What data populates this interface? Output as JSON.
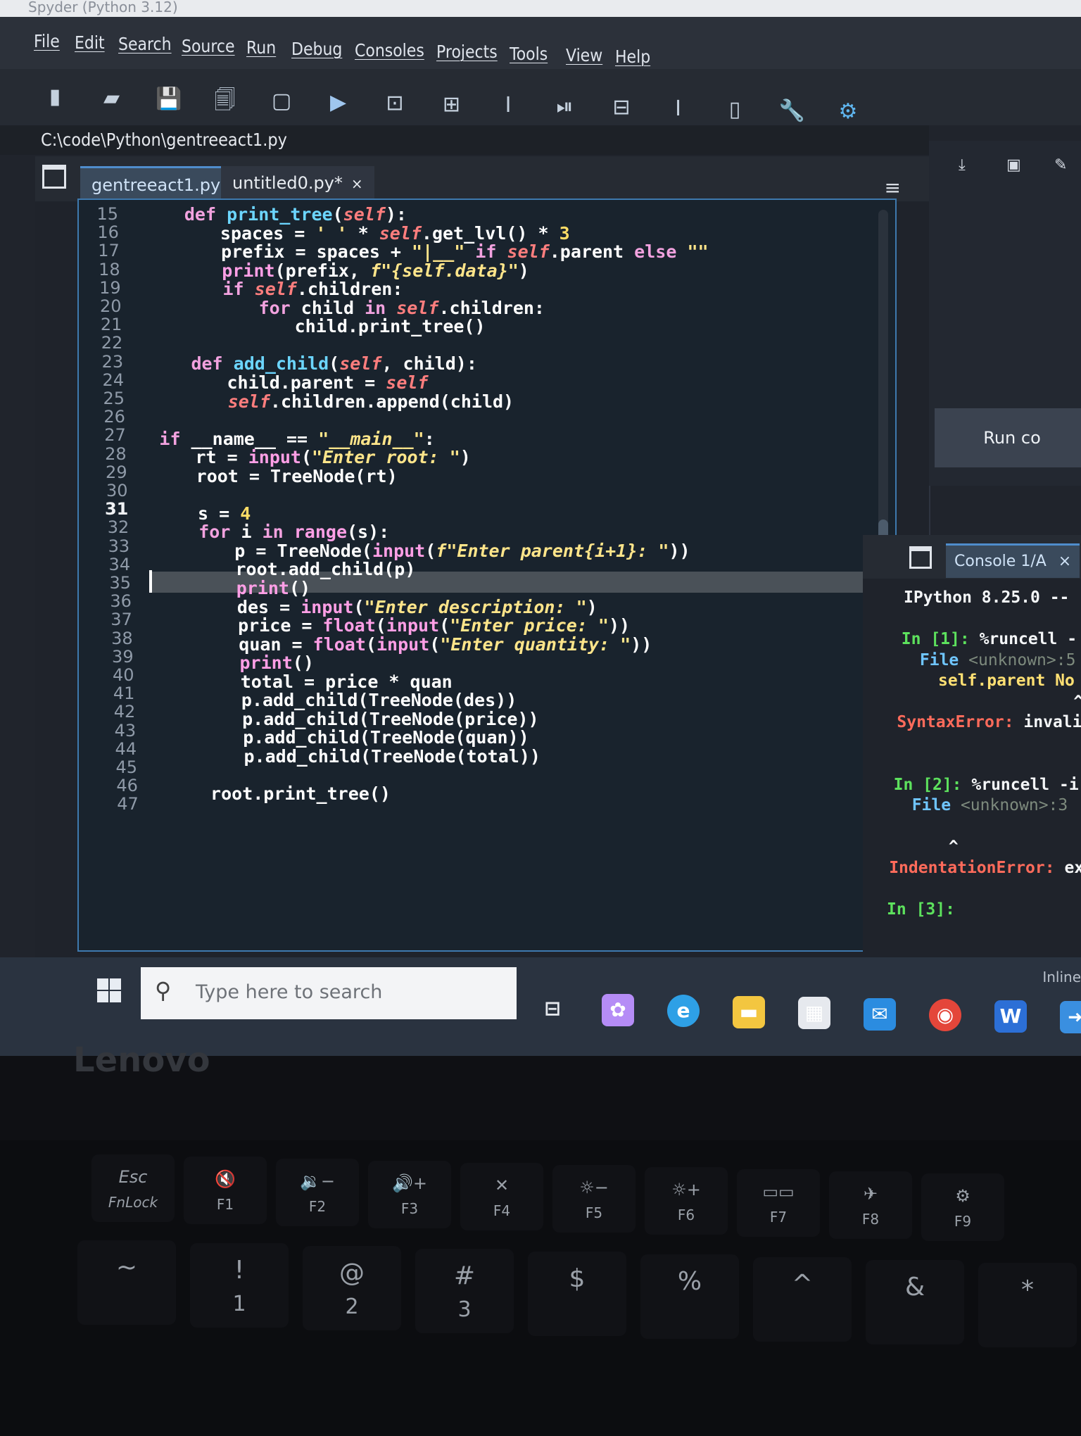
{
  "window": {
    "title": "Spyder (Python 3.12)"
  },
  "menubar": [
    "File",
    "Edit",
    "Search",
    "Source",
    "Run",
    "Debug",
    "Consoles",
    "Projects",
    "Tools",
    "View",
    "Help"
  ],
  "toolbar": {
    "icons": [
      "new-file-icon",
      "open-folder-icon",
      "save-icon",
      "save-all-icon",
      "new-cell-icon",
      "run-icon",
      "run-cell-icon",
      "run-cell-advance-icon",
      "run-selection-icon",
      "debug-icon",
      "debug-cell-icon",
      "debug-selection-icon",
      "maximize-pane-icon",
      "preferences-wrench-icon",
      "python-path-icon"
    ]
  },
  "editor": {
    "path": "C:\\code\\Python\\gentreeact1.py",
    "tabs": [
      {
        "label": "gentreeact1.py",
        "close": "×",
        "active": true
      },
      {
        "label": "untitled0.py*",
        "close": "×",
        "active": false
      }
    ],
    "options_icon": "≡",
    "current_line": 31,
    "lines": [
      {
        "n": "15",
        "indent": 4,
        "tokens": [
          [
            "kw",
            "def "
          ],
          [
            "fn",
            "print_tree"
          ],
          [
            "tx",
            "("
          ],
          [
            "self",
            "self"
          ],
          [
            "tx",
            "):"
          ]
        ]
      },
      {
        "n": "16",
        "indent": 8,
        "tokens": [
          [
            "tx",
            "spaces = "
          ],
          [
            "str",
            "' '"
          ],
          [
            "tx",
            " * "
          ],
          [
            "self",
            "self"
          ],
          [
            "tx",
            ".get_lvl() * "
          ],
          [
            "num",
            "3"
          ]
        ]
      },
      {
        "n": "17",
        "indent": 8,
        "tokens": [
          [
            "tx",
            "prefix = spaces + "
          ],
          [
            "str",
            "\"|__\""
          ],
          [
            "tx",
            " "
          ],
          [
            "kw",
            "if "
          ],
          [
            "self",
            "self"
          ],
          [
            "tx",
            ".parent "
          ],
          [
            "kw",
            "else "
          ],
          [
            "str",
            "\"\""
          ]
        ]
      },
      {
        "n": "18",
        "indent": 8,
        "tokens": [
          [
            "bi",
            "print"
          ],
          [
            "tx",
            "(prefix, "
          ],
          [
            "str",
            "f\"{self.data}\""
          ],
          [
            "tx",
            ")"
          ]
        ]
      },
      {
        "n": "19",
        "indent": 8,
        "tokens": [
          [
            "kw",
            "if "
          ],
          [
            "self",
            "self"
          ],
          [
            "tx",
            ".children:"
          ]
        ]
      },
      {
        "n": "20",
        "indent": 12,
        "tokens": [
          [
            "kw",
            "for "
          ],
          [
            "tx",
            "child "
          ],
          [
            "kw",
            "in "
          ],
          [
            "self",
            "self"
          ],
          [
            "tx",
            ".children:"
          ]
        ]
      },
      {
        "n": "21",
        "indent": 16,
        "tokens": [
          [
            "tx",
            "child.print_tree()"
          ]
        ]
      },
      {
        "n": "22",
        "indent": 0,
        "tokens": []
      },
      {
        "n": "23",
        "indent": 4,
        "tokens": [
          [
            "kw",
            "def "
          ],
          [
            "fn",
            "add_child"
          ],
          [
            "tx",
            "("
          ],
          [
            "self",
            "self"
          ],
          [
            "tx",
            ", child):"
          ]
        ]
      },
      {
        "n": "24",
        "indent": 8,
        "tokens": [
          [
            "tx",
            "child.parent = "
          ],
          [
            "self",
            "self"
          ]
        ]
      },
      {
        "n": "25",
        "indent": 8,
        "tokens": [
          [
            "self",
            "self"
          ],
          [
            "tx",
            ".children.append(child)"
          ]
        ]
      },
      {
        "n": "26",
        "indent": 0,
        "tokens": []
      },
      {
        "n": "27",
        "indent": 0,
        "tokens": [
          [
            "kw",
            "if "
          ],
          [
            "tx",
            "__name__ == "
          ],
          [
            "str",
            "\"__main__\""
          ],
          [
            "tx",
            ":"
          ]
        ]
      },
      {
        "n": "28",
        "indent": 4,
        "tokens": [
          [
            "tx",
            "rt = "
          ],
          [
            "bi",
            "input"
          ],
          [
            "tx",
            "("
          ],
          [
            "str",
            "\"Enter root: \""
          ],
          [
            "tx",
            ")"
          ]
        ]
      },
      {
        "n": "29",
        "indent": 4,
        "tokens": [
          [
            "tx",
            "root = TreeNode(rt)"
          ]
        ]
      },
      {
        "n": "30",
        "indent": 0,
        "tokens": []
      },
      {
        "n": "31",
        "indent": 4,
        "tokens": [
          [
            "tx",
            "s = "
          ],
          [
            "num",
            "4"
          ]
        ]
      },
      {
        "n": "32",
        "indent": 4,
        "tokens": [
          [
            "kw",
            "for "
          ],
          [
            "tx",
            "i "
          ],
          [
            "kw",
            "in "
          ],
          [
            "bi",
            "range"
          ],
          [
            "tx",
            "(s):"
          ]
        ]
      },
      {
        "n": "33",
        "indent": 8,
        "tokens": [
          [
            "tx",
            "p = TreeNode("
          ],
          [
            "bi",
            "input"
          ],
          [
            "tx",
            "("
          ],
          [
            "str",
            "f\"Enter parent{i+1}: \""
          ],
          [
            "tx",
            "))"
          ]
        ]
      },
      {
        "n": "34",
        "indent": 8,
        "tokens": [
          [
            "tx",
            "root.add_child(p)"
          ]
        ]
      },
      {
        "n": "35",
        "indent": 8,
        "tokens": [
          [
            "bi",
            "print"
          ],
          [
            "tx",
            "()"
          ]
        ]
      },
      {
        "n": "36",
        "indent": 8,
        "tokens": [
          [
            "tx",
            "des = "
          ],
          [
            "bi",
            "input"
          ],
          [
            "tx",
            "("
          ],
          [
            "str",
            "\"Enter description: \""
          ],
          [
            "tx",
            ")"
          ]
        ]
      },
      {
        "n": "37",
        "indent": 8,
        "tokens": [
          [
            "tx",
            "price = "
          ],
          [
            "bi",
            "float"
          ],
          [
            "tx",
            "("
          ],
          [
            "bi",
            "input"
          ],
          [
            "tx",
            "("
          ],
          [
            "str",
            "\"Enter price: \""
          ],
          [
            "tx",
            "))"
          ]
        ]
      },
      {
        "n": "38",
        "indent": 8,
        "tokens": [
          [
            "tx",
            "quan = "
          ],
          [
            "bi",
            "float"
          ],
          [
            "tx",
            "("
          ],
          [
            "bi",
            "input"
          ],
          [
            "tx",
            "("
          ],
          [
            "str",
            "\"Enter quantity: \""
          ],
          [
            "tx",
            "))"
          ]
        ]
      },
      {
        "n": "39",
        "indent": 8,
        "tokens": [
          [
            "bi",
            "print"
          ],
          [
            "tx",
            "()"
          ]
        ]
      },
      {
        "n": "40",
        "indent": 8,
        "tokens": [
          [
            "tx",
            "total = price * quan"
          ]
        ]
      },
      {
        "n": "41",
        "indent": 8,
        "tokens": [
          [
            "tx",
            "p.add_child(TreeNode(des))"
          ]
        ]
      },
      {
        "n": "42",
        "indent": 8,
        "tokens": [
          [
            "tx",
            "p.add_child(TreeNode(price))"
          ]
        ]
      },
      {
        "n": "43",
        "indent": 8,
        "tokens": [
          [
            "tx",
            "p.add_child(TreeNode(quan))"
          ]
        ]
      },
      {
        "n": "44",
        "indent": 8,
        "tokens": [
          [
            "tx",
            "p.add_child(TreeNode(total))"
          ]
        ]
      },
      {
        "n": "45",
        "indent": 0,
        "tokens": []
      },
      {
        "n": "46",
        "indent": 4,
        "tokens": [
          [
            "tx",
            "root.print_tree()"
          ]
        ]
      },
      {
        "n": "47",
        "indent": 0,
        "tokens": []
      }
    ]
  },
  "right_pane": {
    "buttons": [
      "import-data-icon",
      "save-data-icon",
      "remove-data-icon"
    ],
    "run_code_label": "Run co"
  },
  "console": {
    "tab_label": "Console 1/A",
    "tab_close": "×",
    "lines": [
      [
        [
          "pl",
          "IPython 8.25.0 --"
        ]
      ],
      [],
      [
        [
          "pr",
          "In [1]: "
        ],
        [
          "pl",
          "%runcell -"
        ]
      ],
      [
        [
          "fl",
          "  File "
        ],
        [
          "dim",
          "<unknown>:5"
        ]
      ],
      [
        [
          "ye",
          "    self.parent No"
        ]
      ],
      [
        [
          "pl",
          "                  ^"
        ]
      ],
      [
        [
          "er",
          "SyntaxError:"
        ],
        [
          "pl",
          " invali"
        ]
      ],
      [],
      [],
      [
        [
          "pr",
          "In [2]: "
        ],
        [
          "pl",
          "%runcell -i"
        ]
      ],
      [
        [
          "fl",
          "  File "
        ],
        [
          "dim",
          "<unknown>:3"
        ]
      ],
      [],
      [
        [
          "pl",
          "      ^"
        ]
      ],
      [
        [
          "er",
          "IndentationError:"
        ],
        [
          "pl",
          " exp"
        ]
      ],
      [],
      [
        [
          "pr",
          "In [3]:"
        ]
      ]
    ],
    "status_label": "Inline"
  },
  "taskbar": {
    "search_placeholder": "Type here to search",
    "apps": [
      "task-view-icon",
      "copilot-icon",
      "edge-icon",
      "file-explorer-icon",
      "store-icon",
      "mail-icon",
      "chrome-icon",
      "word-icon",
      "spyder-icon"
    ]
  },
  "bezel": {
    "brand": "Lenovo"
  },
  "keyboard": {
    "keys": [
      {
        "top": "Esc",
        "bottom": "FnLock"
      },
      {
        "top": "🔇",
        "bottom": "F1"
      },
      {
        "top": "🔉−",
        "bottom": "F2"
      },
      {
        "top": "🔊+",
        "bottom": "F3"
      },
      {
        "top": "✕",
        "bottom": "F4"
      },
      {
        "top": "☼−",
        "bottom": "F5"
      },
      {
        "top": "☼+",
        "bottom": "F6"
      },
      {
        "top": "▭▭",
        "bottom": "F7"
      },
      {
        "top": "✈",
        "bottom": "F8"
      },
      {
        "top": "⚙",
        "bottom": "F9"
      }
    ],
    "number_row": [
      "~",
      "!",
      "@",
      "#",
      "$",
      "%",
      "^",
      "&",
      "*"
    ],
    "number_row_bottom": [
      "",
      "1",
      "2",
      "3",
      "",
      "",
      "",
      "",
      ""
    ]
  },
  "colors": {
    "kw": "#f2a2df",
    "fn": "#6cd6ff",
    "self": "#ff7e7e",
    "str": "#ffe58a",
    "num": "#ffdd66",
    "bi": "#ff9fe6",
    "tx": "#ffffff",
    "pr": "#5de15d",
    "pl": "#f4f6f8",
    "fl": "#6fc5ff",
    "dim": "#7d8a7d",
    "ye": "#ffe073",
    "er": "#ff6b5b"
  }
}
